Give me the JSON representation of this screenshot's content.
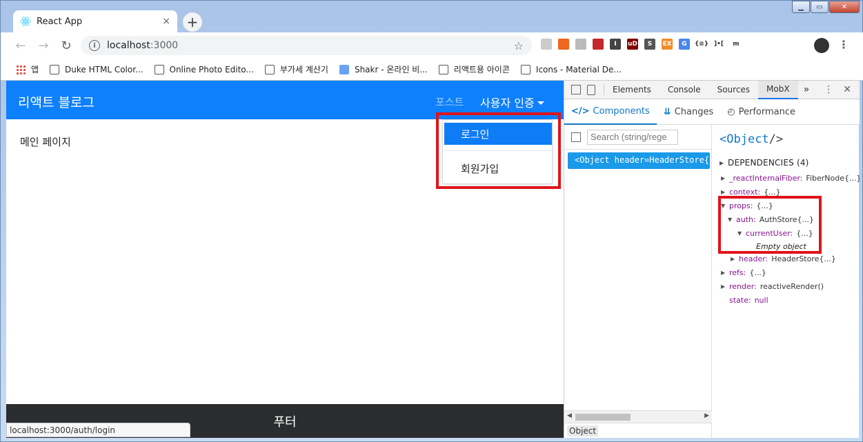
{
  "browser": {
    "tab_title": "React App",
    "tab_close": "×",
    "new_tab": "+",
    "url_host": "localhost",
    "url_port": ":3000",
    "extensions": [
      {
        "name": "ext-clip-icon",
        "color": "#cccccc",
        "label": ""
      },
      {
        "name": "ext-orange-icon",
        "color": "#f0651f",
        "label": ""
      },
      {
        "name": "ext-fingerprint-icon",
        "color": "#bbbbbb",
        "label": ""
      },
      {
        "name": "ext-puzzle-icon",
        "color": "#c5282c",
        "label": ""
      },
      {
        "name": "ext-instapaper-icon",
        "color": "#444444",
        "label": "I"
      },
      {
        "name": "ext-ublock-icon",
        "color": "#800000",
        "label": "uD"
      },
      {
        "name": "ext-s-icon",
        "color": "#555555",
        "label": "S"
      },
      {
        "name": "ext-ex-icon",
        "color": "#f08c2c",
        "label": "EX"
      },
      {
        "name": "ext-translate-icon",
        "color": "#4a86e8",
        "label": "G"
      },
      {
        "name": "ext-json-icon",
        "color": "#ffffff",
        "label": "{≡}"
      },
      {
        "name": "ext-mobx-icon",
        "color": "#ffffff",
        "label": "]•["
      },
      {
        "name": "ext-m-icon",
        "color": "#ffffff",
        "label": "m"
      }
    ],
    "bookmarks": [
      {
        "label": "앱",
        "color": "#e94335",
        "name": "bookmark-apps"
      },
      {
        "label": "Duke HTML Color...",
        "color": "#ffffff",
        "name": "bookmark-duke"
      },
      {
        "label": "Online Photo Edito...",
        "color": "#ffffff",
        "name": "bookmark-photo-editor"
      },
      {
        "label": "부가세 계산기",
        "color": "#ffffff",
        "name": "bookmark-vat-calculator"
      },
      {
        "label": "Shakr - 온라인 비...",
        "color": "#6aa2f4",
        "name": "bookmark-shakr"
      },
      {
        "label": "리액트용 아이콘",
        "color": "#ffffff",
        "name": "bookmark-react-icons"
      },
      {
        "label": "Icons - Material De...",
        "color": "#ffffff",
        "name": "bookmark-material-icons"
      }
    ]
  },
  "app": {
    "brand": "리액트 블로그",
    "nav_post": "포스트",
    "nav_auth": "사용자 인증",
    "dropdown": {
      "login": "로그인",
      "signup": "회원가입"
    },
    "main_text": "메인 페이지",
    "footer": "푸터",
    "status_url": "localhost:3000/auth/login"
  },
  "devtools": {
    "tabs": [
      "Elements",
      "Console",
      "Sources",
      "MobX"
    ],
    "selected_tab": "MobX",
    "more": "»",
    "mobx_tabs": {
      "components": "Components",
      "changes": "Changes",
      "performance": "Performance"
    },
    "search_placeholder": "Search (string/rege",
    "tree_node": "<Object header=HeaderStore{...",
    "crumb": "Object",
    "inspector": {
      "title": "Object",
      "dependencies": "DEPENDENCIES (4)",
      "rows": {
        "internal_fiber_key": "_reactInternalFiber:",
        "internal_fiber_val": "FiberNode{...}",
        "context_key": "context:",
        "context_val": "{...}",
        "props_key": "props:",
        "props_val": "{...}",
        "auth_key": "auth:",
        "auth_val": "AuthStore{...}",
        "current_user_key": "currentUser:",
        "current_user_val": "{...}",
        "empty_object": "Empty object",
        "header_key": "header:",
        "header_val": "HeaderStore{...}",
        "refs_key": "refs:",
        "refs_val": "{...}",
        "render_key": "render:",
        "render_val": "reactiveRender()",
        "state_key": "state:",
        "state_val": "null"
      }
    }
  },
  "colors": {
    "navbar": "#0e80fb",
    "dropdown_active": "#0e7cf5",
    "footer": "#2a2c2e",
    "highlight_box": "#e0131b",
    "mobx_accent": "#0e77c7"
  }
}
